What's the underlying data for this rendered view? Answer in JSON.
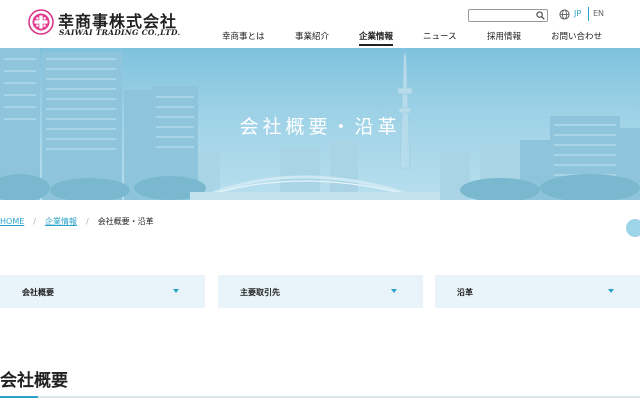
{
  "header": {
    "logo_jp": "幸商事株式会社",
    "logo_en": "SAIWAI TRADING CO.,LTD.",
    "search": {
      "placeholder": "",
      "value": ""
    },
    "lang": {
      "jp": "JP",
      "en": "EN",
      "active": "JP"
    },
    "nav": [
      {
        "label": "幸商事とは",
        "active": false
      },
      {
        "label": "事業紹介",
        "active": false
      },
      {
        "label": "企業情報",
        "active": true
      },
      {
        "label": "ニュース",
        "active": false
      },
      {
        "label": "採用情報",
        "active": false
      },
      {
        "label": "お問い合わせ",
        "active": false
      }
    ]
  },
  "hero": {
    "title": "会社概要・沿革"
  },
  "breadcrumb": {
    "items": [
      {
        "label": "HOME"
      },
      {
        "label": "企業情報"
      }
    ],
    "current": "会社概要・沿革"
  },
  "tabs": [
    {
      "label": "会社概要"
    },
    {
      "label": "主要取引先"
    },
    {
      "label": "沿革"
    }
  ],
  "section": {
    "title": "会社概要"
  },
  "colors": {
    "accent": "#2ba3c8",
    "tab_bg": "#e8f4f9",
    "hero_sky": "#8fcbe2"
  },
  "icons": [
    "logo-mark-icon",
    "search-icon",
    "globe-icon",
    "chevron-down-icon"
  ]
}
